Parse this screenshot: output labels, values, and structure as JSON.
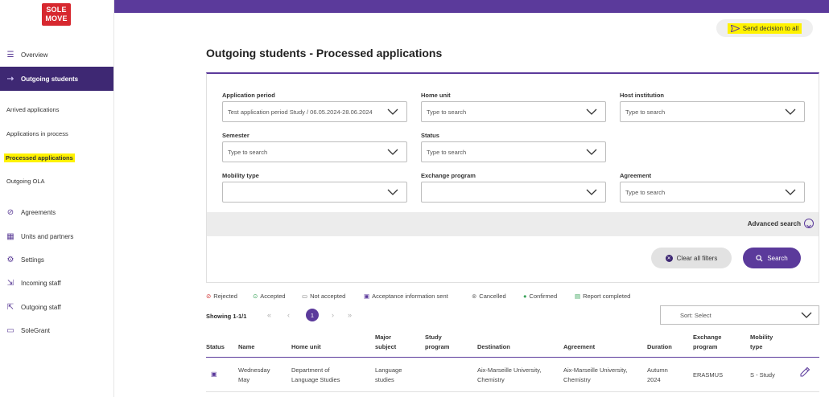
{
  "app": {
    "logo_line1": "SOLE",
    "logo_line2": "MOVE"
  },
  "sidebar": {
    "overview": "Overview",
    "outgoing_students": "Outgoing students",
    "sub_items": [
      "Arrived applications",
      "Applications in process",
      "Processed applications",
      "Outgoing OLA"
    ],
    "agreements": "Agreements",
    "units_partners": "Units and partners",
    "settings": "Settings",
    "incoming_staff": "Incoming staff",
    "outgoing_staff": "Outgoing staff",
    "solegrant": "SoleGrant"
  },
  "header": {
    "send_decision": "Send decision to all"
  },
  "page": {
    "title": "Outgoing students - Processed applications"
  },
  "filters": {
    "application_period": {
      "label": "Application period",
      "value": "Test application period Study / 06.05.2024-28.06.2024"
    },
    "home_unit": {
      "label": "Home unit",
      "placeholder": "Type to search"
    },
    "host_institution": {
      "label": "Host institution",
      "placeholder": "Type to search"
    },
    "semester": {
      "label": "Semester",
      "placeholder": "Type to search"
    },
    "status": {
      "label": "Status",
      "placeholder": "Type to search"
    },
    "mobility_type": {
      "label": "Mobility type",
      "value": ""
    },
    "exchange_program": {
      "label": "Exchange program",
      "value": ""
    },
    "agreement": {
      "label": "Agreement",
      "placeholder": "Type to search"
    },
    "advanced_search": "Advanced search",
    "clear_all": "Clear all filters",
    "search": "Search"
  },
  "legend": [
    "Rejected",
    "Accepted",
    "Not accepted",
    "Acceptance information sent",
    "Cancelled",
    "Confirmed",
    "Report completed"
  ],
  "pagination": {
    "showing": "Showing 1-1/1",
    "current_page": "1"
  },
  "sort": {
    "label": "Sort: Select"
  },
  "table": {
    "headers": {
      "status": "Status",
      "name": "Name",
      "home_unit": "Home unit",
      "major_1": "Major",
      "major_2": "subject",
      "study_1": "Study",
      "study_2": "program",
      "destination": "Destination",
      "agreement": "Agreement",
      "duration": "Duration",
      "exchange_1": "Exchange",
      "exchange_2": "program",
      "mobility_1": "Mobility",
      "mobility_2": "type"
    },
    "rows": [
      {
        "name_1": "Wednesday",
        "name_2": "May",
        "home_unit_1": "Department of",
        "home_unit_2": "Language Studies",
        "major_1": "Language",
        "major_2": "studies",
        "destination_1": "Aix-Marseille University,",
        "destination_2": "Chemistry",
        "agreement_1": "Aix-Marseille University,",
        "agreement_2": "Chemistry",
        "duration_1": "Autumn",
        "duration_2": "2024",
        "exchange": "ERASMUS",
        "mobility": "S - Study"
      }
    ]
  }
}
